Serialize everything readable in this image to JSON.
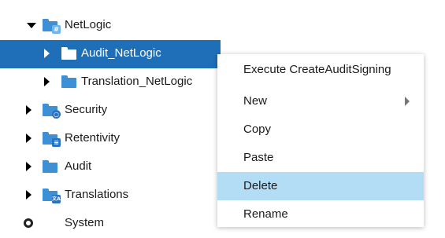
{
  "tree": {
    "items": [
      {
        "label": "NetLogic",
        "icon": "netlogic-folder-icon",
        "expanded": true
      },
      {
        "label": "Audit_NetLogic",
        "icon": "folder-icon",
        "selected": true
      },
      {
        "label": "Translation_NetLogic",
        "icon": "folder-icon"
      },
      {
        "label": "Security",
        "icon": "security-folder-icon"
      },
      {
        "label": "Retentivity",
        "icon": "retentivity-folder-icon"
      },
      {
        "label": "Audit",
        "icon": "folder-icon"
      },
      {
        "label": "Translations",
        "icon": "translations-folder-icon"
      },
      {
        "label": "System",
        "icon": "system-icon"
      }
    ]
  },
  "context_menu": {
    "items": [
      {
        "label": "Execute CreateAuditSigning"
      },
      {
        "label": "New",
        "has_submenu": true
      },
      {
        "label": "Copy"
      },
      {
        "label": "Paste"
      },
      {
        "label": "Delete",
        "highlighted": true
      },
      {
        "label": "Rename"
      }
    ]
  },
  "colors": {
    "selection": "#1f6fb8",
    "menu_highlight": "#b3dcf5",
    "folder": "#3d8fd6"
  }
}
